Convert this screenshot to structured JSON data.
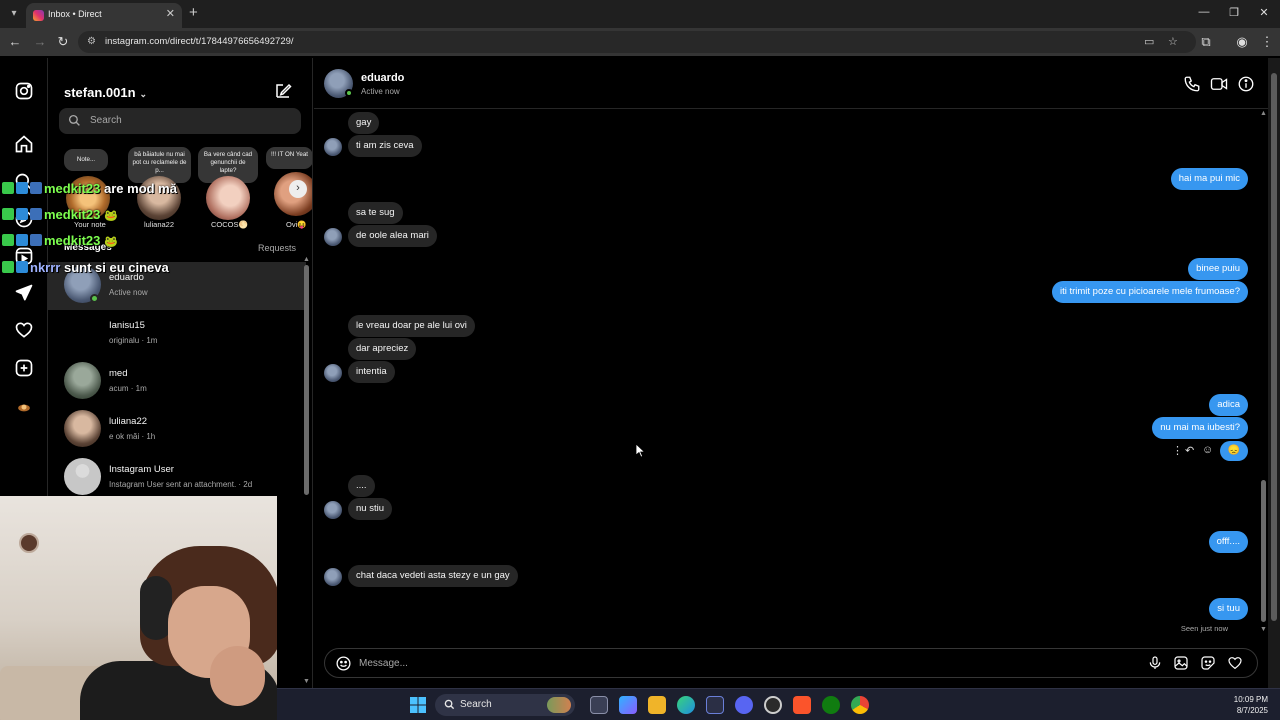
{
  "browser": {
    "tab_title": "Inbox • Direct",
    "url": "instagram.com/direct/t/17844976656492729/",
    "new_tab": "+",
    "close_tab": "✕",
    "minimize": "—",
    "restore": "❐",
    "close_window": "✕"
  },
  "sidebar": {
    "username": "stefan.001n",
    "search_placeholder": "Search",
    "messages_label": "Messages",
    "requests_label": "Requests",
    "notes": [
      {
        "text": "Note...",
        "name": "Your note"
      },
      {
        "text": "bă băiatule nu mai pot cu reclamele de p...",
        "name": "luliana22"
      },
      {
        "text": "Ba vere când cad genunchii de lapte?",
        "name": "COCOS🌕"
      },
      {
        "text": "!!! IT ON Yeat",
        "name": "Ovi😝"
      }
    ],
    "conversations": [
      {
        "name": "eduardo",
        "sub": "Active now"
      },
      {
        "name": "Ianisu15",
        "sub": "originalu · 1m"
      },
      {
        "name": "med",
        "sub": "acum · 1m"
      },
      {
        "name": "luliana22",
        "sub": "e ok măi · 1h"
      },
      {
        "name": "Instagram User",
        "sub": "Instagram User sent an attachment. · 2d"
      }
    ]
  },
  "overlay": [
    {
      "user": "medkit23",
      "text": "are mod mă"
    },
    {
      "user": "medkit23",
      "text": ""
    },
    {
      "user": "medkit23",
      "text": ""
    },
    {
      "user": "nkrrr",
      "text": "sunt si eu cineva"
    }
  ],
  "chat": {
    "contact_name": "eduardo",
    "contact_status": "Active now",
    "messages": [
      {
        "dir": "in",
        "text": "gay"
      },
      {
        "dir": "in",
        "text": "ti am zis ceva"
      },
      {
        "dir": "out",
        "text": "hai ma pui mic"
      },
      {
        "dir": "in",
        "text": "sa te sug"
      },
      {
        "dir": "in",
        "text": "de oole alea mari"
      },
      {
        "dir": "out",
        "text": "binee puiu"
      },
      {
        "dir": "out",
        "text": "iti trimit poze cu picioarele mele frumoase?"
      },
      {
        "dir": "in",
        "text": "le vreau doar pe ale lui ovi"
      },
      {
        "dir": "in",
        "text": "dar apreciez"
      },
      {
        "dir": "in",
        "text": "intentia"
      },
      {
        "dir": "out",
        "text": "adica"
      },
      {
        "dir": "out",
        "text": "nu mai ma iubesti?"
      },
      {
        "dir": "out",
        "text": "😞"
      },
      {
        "dir": "in",
        "text": "...."
      },
      {
        "dir": "in",
        "text": "nu stiu"
      },
      {
        "dir": "out",
        "text": "offf...."
      },
      {
        "dir": "in",
        "text": "chat daca vedeti asta stezy e un gay"
      },
      {
        "dir": "out",
        "text": "si tuu"
      }
    ],
    "seen_label": "Seen just now",
    "composer_placeholder": "Message..."
  },
  "taskbar": {
    "search_label": "Search",
    "time": "10:09 PM",
    "date": "8/7/2025"
  },
  "icons": {
    "instagram": "instagram-icon",
    "home": "home-icon",
    "search": "search-icon",
    "reels": "reels-icon",
    "direct": "direct-icon",
    "notifications": "heart-icon",
    "create": "plus-icon",
    "compose": "compose-icon",
    "phone": "phone-icon",
    "video": "video-icon",
    "info": "info-icon",
    "emoji": "emoji-icon",
    "mic": "microphone-icon",
    "image": "image-icon",
    "sticker": "sticker-icon",
    "like": "heart-icon"
  },
  "colors": {
    "outgoing_bubble": "#3797f0",
    "incoming_bubble": "#262626",
    "background": "#000000",
    "online": "#5ac24b"
  }
}
